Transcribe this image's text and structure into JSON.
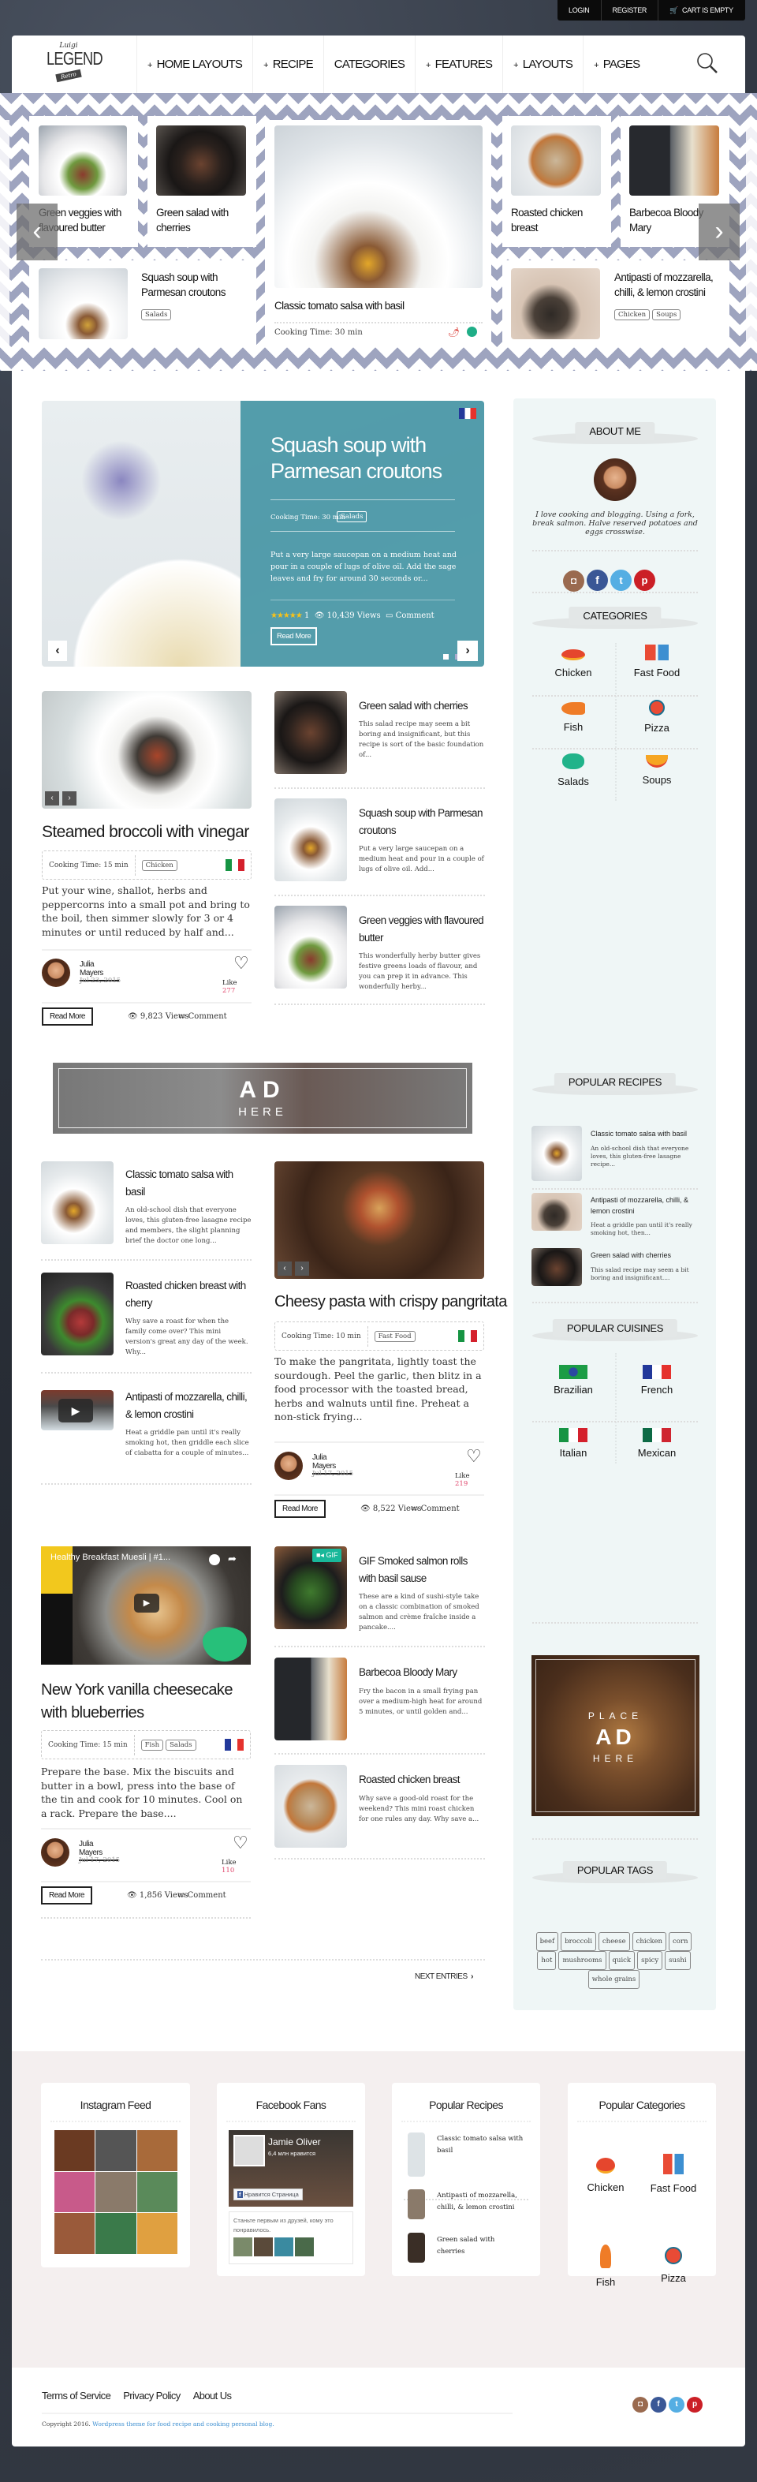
{
  "topbar": {
    "login": "LOGIN",
    "register": "REGISTER",
    "cart": "CART IS EMPTY"
  },
  "header": {
    "logo_script": "Luigi",
    "logo": "LEGEND",
    "logo_badge": "Retro",
    "nav": [
      "HOME LAYOUTS",
      "RECIPE",
      "CATEGORIES",
      "FEATURES",
      "LAYOUTS",
      "PAGES"
    ],
    "nav_has_plus": [
      true,
      true,
      false,
      true,
      true,
      true
    ]
  },
  "slider": {
    "cards": [
      {
        "title": "Green veggies with flavoured butter"
      },
      {
        "title": "Green salad with cherries"
      },
      {
        "title": "Squash soup with Parmesan croutons",
        "tags": [
          "Salads"
        ]
      },
      {
        "title": "Classic tomato salsa with basil",
        "cooking": "Cooking Time: 30 min"
      },
      {
        "title": "Roasted chicken breast"
      },
      {
        "title": "Barbecoa Bloody Mary"
      },
      {
        "title": "Antipasti of mozzarella, chilli, & lemon crostini",
        "tags": [
          "Chicken",
          "Soups"
        ]
      }
    ]
  },
  "featured": {
    "title": "Squash soup with Parmesan croutons",
    "cooking": "Cooking Time: 30 min",
    "tag": "Salads",
    "excerpt": "Put a very large saucepan on a medium heat and pour in a couple of lugs of olive oil. Add the sage leaves and fry for around 30 seconds or...",
    "stars": "★★★★★",
    "rating_count": "1",
    "views": "10,439 Views",
    "comment": "Comment",
    "read_more": "Read More",
    "cuisine": "French",
    "slide_count": 2,
    "active_slide": 1
  },
  "posts": [
    {
      "title": "Steamed broccoli with vinegar",
      "cooking": "Cooking Time: 15 min",
      "tags": [
        "Chicken"
      ],
      "cuisine": "Italian",
      "excerpt": "Put your wine, shallot, herbs and peppercorns into a small pot and bring to the boil, then simmer slowly for 3 or 4 minutes or until reduced by half and...",
      "author": "Julia Mayers",
      "date": "Jul 23, 2015",
      "like_label": "Like",
      "likes": "277",
      "views": "9,823 Views",
      "comment": "Comment",
      "read_more": "Read More"
    },
    {
      "title": "Cheesy pasta with crispy pangritata",
      "cooking": "Cooking Time: 10 min",
      "tags": [
        "Fast Food"
      ],
      "cuisine": "Italian",
      "excerpt": "To make the pangritata, lightly toast the sourdough. Peel the garlic, then blitz in a food processor with the toasted bread, herbs and walnuts until fine. Preheat a non-stick frying...",
      "author": "Julia Mayers",
      "date": "Jul 17, 2015",
      "like_label": "Like",
      "likes": "219",
      "views": "8,522 Views",
      "comment": "Comment",
      "read_more": "Read More"
    },
    {
      "title": "New York vanilla cheesecake with blueberries",
      "video_title": "Healthy Breakfast Muesli | #1...",
      "cooking": "Cooking Time: 15 min",
      "tags": [
        "Fish",
        "Salads"
      ],
      "cuisine": "French",
      "excerpt": "Prepare the base. Mix the biscuits and butter in a bowl, press into the base of the tin and cook for 10 minutes. Cool on a rack. Prepare the base....",
      "author": "Julia Mayers",
      "date": "Jul 17, 2015",
      "like_label": "Like",
      "likes": "110",
      "views": "1,856 Views",
      "comment": "Comment",
      "read_more": "Read More"
    }
  ],
  "lists": [
    [
      {
        "title": "Green salad with cherries",
        "excerpt": "This salad recipe may seem a bit boring and insignificant, but this recipe is sort of the basic foundation of..."
      },
      {
        "title": "Squash soup with Parmesan croutons",
        "excerpt": "Put a very large saucepan on a medium heat and pour in a couple of lugs of olive oil. Add..."
      },
      {
        "title": "Green veggies with flavoured butter",
        "excerpt": "This wonderfully herby butter gives festive greens loads of flavour, and you can prep it in advance. This wonderfully herby..."
      }
    ],
    [
      {
        "title": "Classic tomato salsa with basil",
        "excerpt": "An old-school dish that everyone loves, this gluten-free lasagne recipe and members, the slight planning brief the doctor one long..."
      },
      {
        "title": "Roasted chicken breast with cherry",
        "excerpt": "Why save a roast for when the family come over? This mini version's great any day of the week. Why..."
      },
      {
        "title": "Antipasti of mozzarella, chilli, & lemon crostini",
        "excerpt": "Heat a griddle pan until it's really smoking hot, then griddle each slice of ciabatta for a couple of minutes..."
      }
    ],
    [
      {
        "title": "GIF Smoked salmon rolls with basil sause",
        "excerpt": "These are a kind of sushi-style take on a classic combination of smoked salmon and crème fraîche inside a pancake....",
        "badge": "GIF"
      },
      {
        "title": "Barbecoa Bloody Mary",
        "excerpt": "Fry the bacon in a small frying pan over a medium-high heat for around 5 minutes, or until golden and..."
      },
      {
        "title": "Roasted chicken breast",
        "excerpt": "Why save a good-old roast for the weekend? This mini roast chicken for one rules any day. Why save a..."
      }
    ]
  ],
  "ad_banner": {
    "line1": "AD",
    "line2": "HERE"
  },
  "pagination": {
    "next": "NEXT ENTRIES"
  },
  "sidebar": {
    "about": {
      "heading": "ABOUT ME",
      "text": "I love cooking and blogging. Using a fork, break salmon. Halve reserved potatoes and eggs crosswise."
    },
    "social": [
      "instagram",
      "facebook",
      "twitter",
      "pinterest"
    ],
    "categories": {
      "heading": "CATEGORIES",
      "items": [
        "Chicken",
        "Fast Food",
        "Fish",
        "Pizza",
        "Salads",
        "Soups"
      ]
    },
    "popular_recipes": {
      "heading": "POPULAR RECIPES",
      "items": [
        {
          "title": "Classic tomato salsa with basil",
          "excerpt": "An old-school dish that everyone loves, this gluten-free lasagne recipe..."
        },
        {
          "title": "Antipasti of mozzarella, chilli, & lemon crostini",
          "excerpt": "Heat a griddle pan until it's really smoking hot, then..."
        },
        {
          "title": "Green salad with cherries",
          "excerpt": "This salad recipe may seem a bit boring and insignificant...."
        }
      ]
    },
    "cuisines": {
      "heading": "POPULAR CUISINES",
      "items": [
        "Brazilian",
        "French",
        "Italian",
        "Mexican"
      ]
    },
    "ad": {
      "line1": "PLACE",
      "line2": "AD",
      "line3": "HERE"
    },
    "tags": {
      "heading": "POPULAR TAGS",
      "items": [
        "beef",
        "broccoli",
        "cheese",
        "chicken",
        "corn",
        "hot",
        "mushrooms",
        "quick",
        "spicy",
        "sushi",
        "whole grains"
      ]
    }
  },
  "footer_widgets": {
    "instagram": {
      "heading": "Instagram Feed"
    },
    "facebook": {
      "heading": "Facebook Fans",
      "page_name": "Jamie Oliver",
      "likes": "6,4 млн нравится",
      "like_button": "Нравится Страница",
      "friends_text": "Станьте первым из друзей, кому это понравилось."
    },
    "recipes": {
      "heading": "Popular Recipes",
      "items": [
        "Classic tomato salsa with basil",
        "Antipasti of mozzarella, chilli, & lemon crostini",
        "Green salad with cherries"
      ]
    },
    "categories": {
      "heading": "Popular Categories",
      "items": [
        "Chicken",
        "Fast Food",
        "Fish",
        "Pizza"
      ]
    }
  },
  "footer": {
    "links": [
      "Terms of Service",
      "Privacy Policy",
      "About Us"
    ],
    "copyright": "Copyright 2016.",
    "copyright_link": "Wordpress theme for food recipe and cooking personal blog."
  },
  "colors": {
    "accent_teal": "#4696a5",
    "like_red": "#e0456b",
    "sidebar_bg": "#eff6f6",
    "pattern": "#9ea4bf",
    "footer_band": "#f4efef",
    "link_blue": "#3d8fd1"
  }
}
